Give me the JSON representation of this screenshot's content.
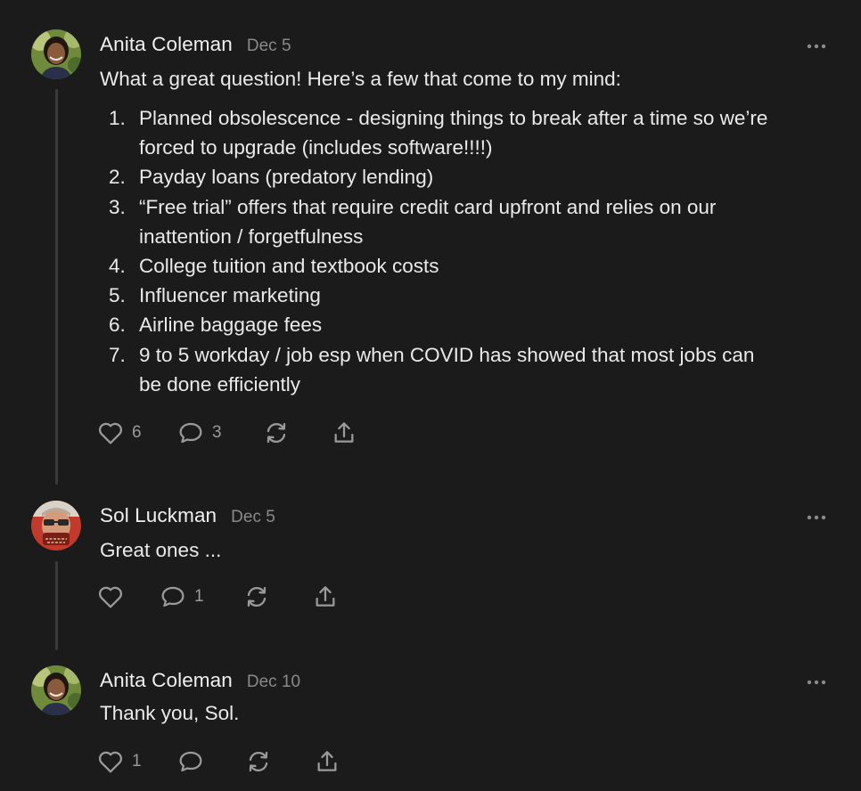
{
  "comments": [
    {
      "author": "Anita Coleman",
      "date": "Dec 5",
      "avatar": "anita-coleman-photo",
      "intro": "What a great question! Here’s a few that come to my mind:",
      "list": [
        {
          "num": "1.",
          "lines": [
            "Planned obsolescence - designing things to break after a time so we’re",
            "forced to upgrade (includes software!!!!)"
          ]
        },
        {
          "num": "2.",
          "lines": [
            "Payday loans (predatory lending)"
          ]
        },
        {
          "num": "3.",
          "lines": [
            "“Free trial” offers that require credit card upfront and relies on our",
            "inattention / forgetfulness"
          ]
        },
        {
          "num": "4.",
          "lines": [
            "College tuition and textbook costs"
          ]
        },
        {
          "num": "5.",
          "lines": [
            "Influencer marketing"
          ]
        },
        {
          "num": "6.",
          "lines": [
            "Airline baggage fees"
          ]
        },
        {
          "num": "7.",
          "lines": [
            "9 to 5 workday / job esp when COVID has showed that most jobs can",
            "be done efficiently"
          ]
        }
      ],
      "likes": "6",
      "replies": "3",
      "icons": [
        "heart-icon",
        "comment-icon",
        "restack-icon",
        "share-icon",
        "more-icon"
      ]
    },
    {
      "author": "Sol Luckman",
      "date": "Dec 5",
      "avatar": "sol-luckman-photo",
      "text": "Great ones ...",
      "likes": "",
      "replies": "1",
      "icons": [
        "heart-icon",
        "comment-icon",
        "restack-icon",
        "share-icon",
        "more-icon"
      ]
    },
    {
      "author": "Anita Coleman",
      "date": "Dec 10",
      "avatar": "anita-coleman-photo",
      "text": "Thank you, Sol.",
      "likes": "1",
      "replies": "",
      "icons": [
        "heart-icon",
        "comment-icon",
        "restack-icon",
        "share-icon",
        "more-icon"
      ]
    }
  ],
  "colors": {
    "background": "#1b1b1c",
    "text": "#eaeaea",
    "muted": "#8a8a8c",
    "thread_line": "#3a3a3b"
  }
}
